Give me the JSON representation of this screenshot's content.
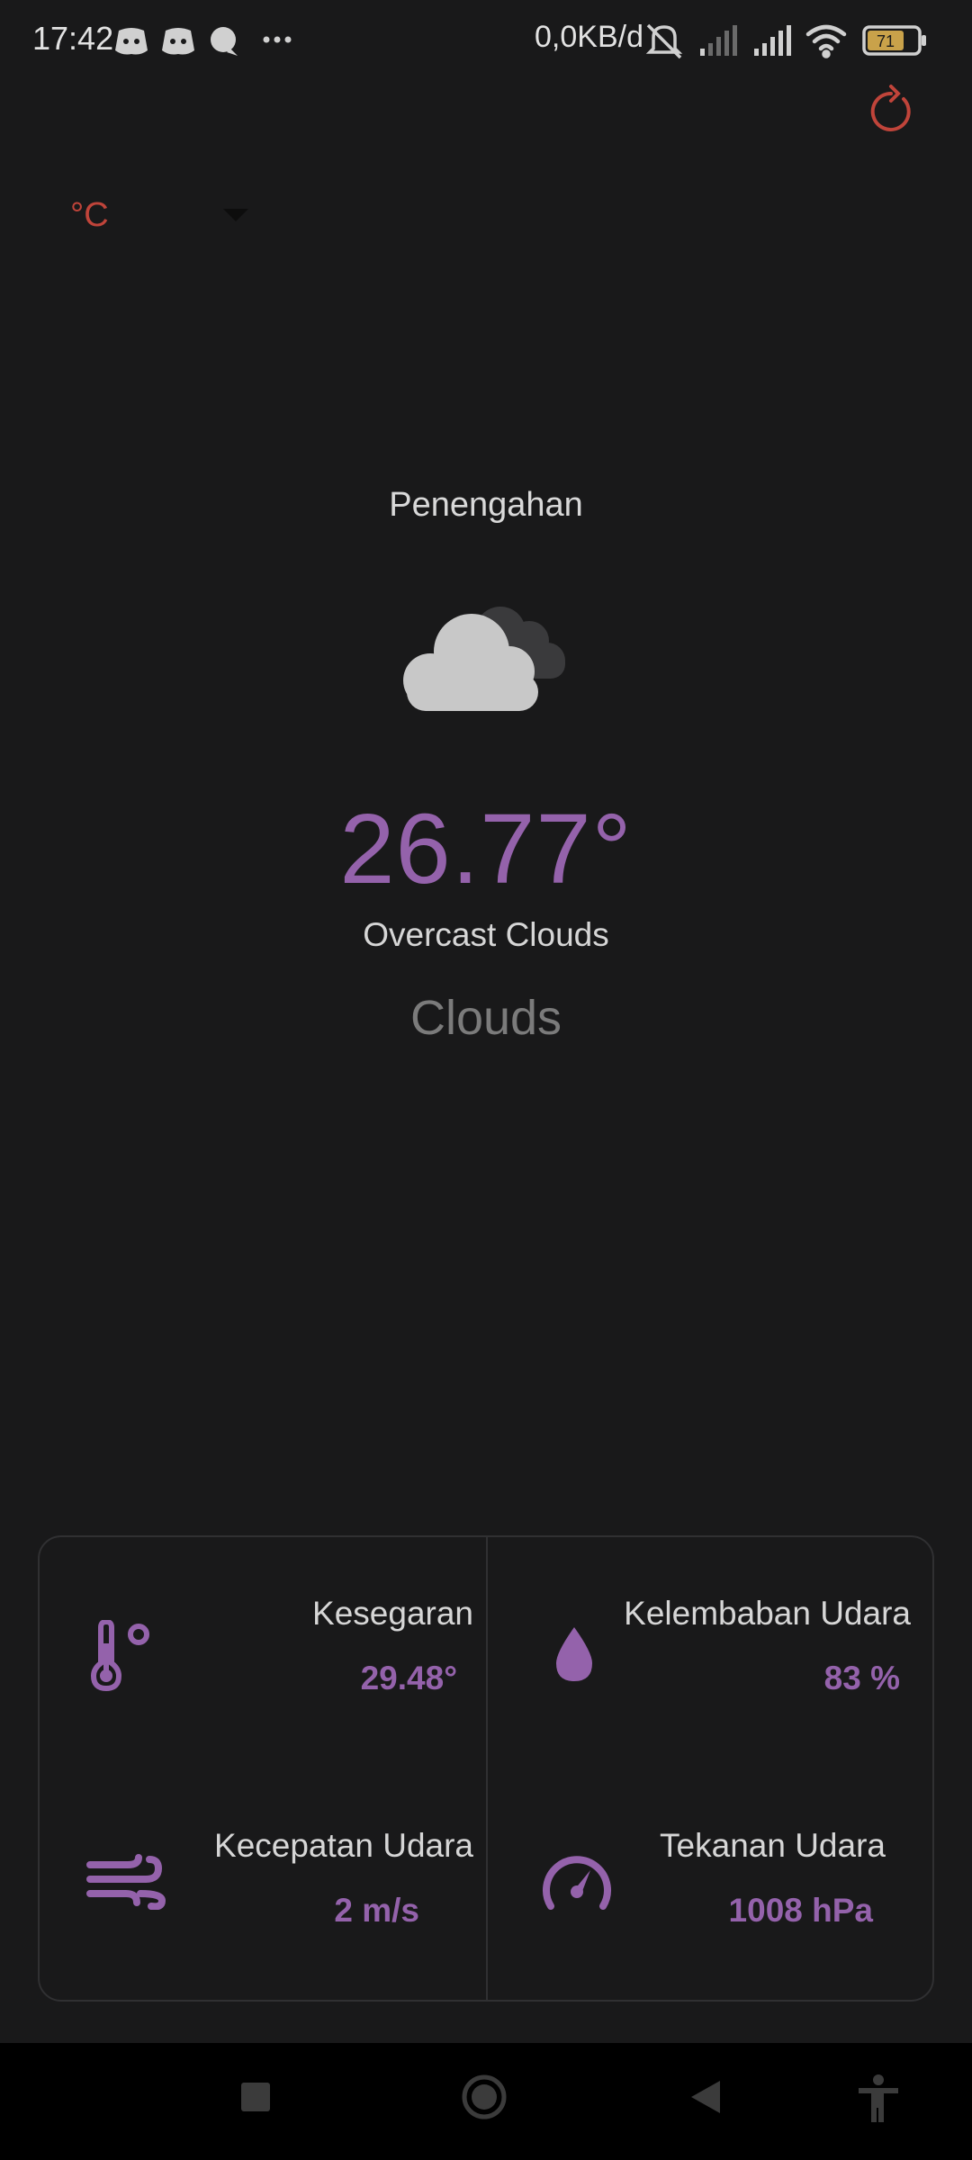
{
  "status_bar": {
    "time": "17:42",
    "net_speed": "0,0KB/d",
    "battery": "71",
    "left_icons": [
      "discord-icon",
      "discord-icon",
      "chat-bubble-icon",
      "more-dots-icon"
    ],
    "right_icons": [
      "bell-off-icon",
      "signal-weak-icon",
      "signal-icon",
      "wifi-icon",
      "battery-icon"
    ]
  },
  "header": {
    "refresh_icon": "refresh-icon",
    "unit_selected": "°C"
  },
  "weather": {
    "city": "Penengahan",
    "icon": "overcast-clouds-icon",
    "temperature": "26.77°",
    "description": "Overcast Clouds",
    "main": "Clouds"
  },
  "details": [
    {
      "label": "Kesegaran",
      "value": "29.48°",
      "icon": "thermometer-icon"
    },
    {
      "label": "Kelembaban Udara",
      "value": "83 %",
      "icon": "humidity-drop-icon"
    },
    {
      "label": "Kecepatan Udara",
      "value": "2 m/s",
      "icon": "wind-icon"
    },
    {
      "label": "Tekanan Udara",
      "value": "1008 hPa",
      "icon": "gauge-icon"
    }
  ],
  "nav": [
    "recents-icon",
    "home-icon",
    "back-icon",
    "accessibility-icon"
  ],
  "colors": {
    "background": "#19191a",
    "accent_purple": "#9462ab",
    "accent_red": "#c0443a"
  }
}
